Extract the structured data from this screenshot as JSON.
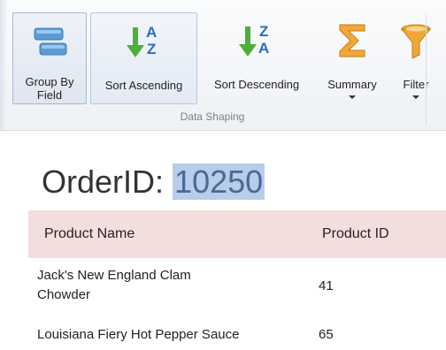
{
  "ribbon": {
    "group_label": "Data Shaping",
    "buttons": [
      {
        "label_line1": "Group By",
        "label_line2": "Field",
        "icon": "group-by-field-icon"
      },
      {
        "label": "Sort Ascending",
        "icon": "sort-ascending-icon"
      },
      {
        "label": "Sort Descending",
        "icon": "sort-descending-icon"
      },
      {
        "label": "Summary",
        "icon": "summary-sigma-icon"
      },
      {
        "label": "Filter",
        "icon": "filter-funnel-icon"
      }
    ]
  },
  "report": {
    "title_label": "OrderID:",
    "title_value": "10250",
    "columns": [
      "Product Name",
      "Product ID"
    ],
    "rows": [
      {
        "name_line1": "Jack's New England Clam",
        "name_line2": "Chowder",
        "id": "41"
      },
      {
        "name": "Louisiana Fiery Hot Pepper Sauce",
        "id": "65"
      }
    ]
  },
  "colors": {
    "accent_green": "#4caf3a",
    "accent_blue": "#2b6cc4",
    "header_bg": "#f3dede",
    "selection": "#b7cde9"
  }
}
